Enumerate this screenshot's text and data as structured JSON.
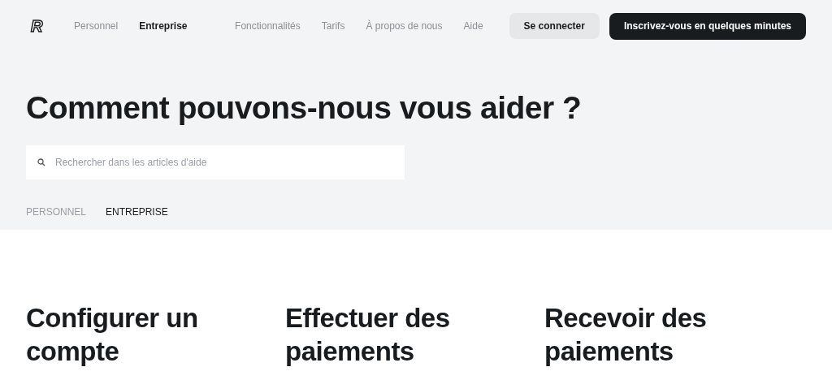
{
  "header": {
    "logo": "R",
    "segments": [
      {
        "label": "Personnel",
        "selected": false
      },
      {
        "label": "Entreprise",
        "selected": true
      }
    ],
    "nav": [
      "Fonctionnalités",
      "Tarifs",
      "À propos de nous",
      "Aide"
    ],
    "login": "Se connecter",
    "signup": "Inscrivez-vous en quelques minutes"
  },
  "hero": {
    "title": "Comment pouvons-nous vous aider ?",
    "search": {
      "placeholder": "Rechercher dans les articles d'aide"
    },
    "tabs": [
      {
        "label": "PERSONNEL",
        "selected": false
      },
      {
        "label": "ENTREPRISE",
        "selected": true
      }
    ]
  },
  "categories": [
    "Configurer un compte",
    "Effectuer des paiements",
    "Recevoir des paiements"
  ]
}
